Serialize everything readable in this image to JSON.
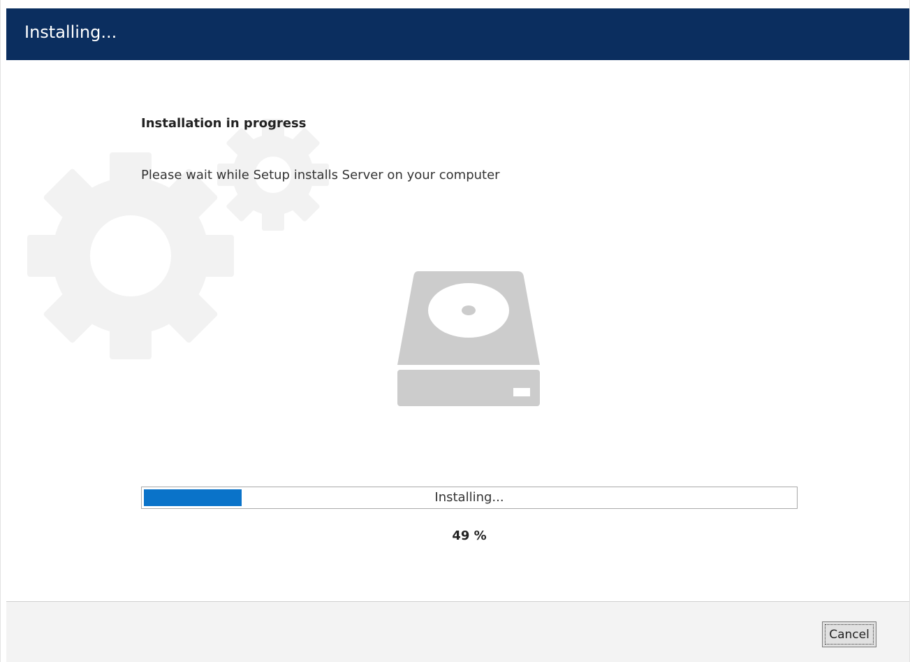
{
  "window": {
    "title": "Installing..."
  },
  "main": {
    "heading": "Installation in progress",
    "description": "Please wait while Setup installs Server on your computer",
    "illustration_icon": "hard-drive-icon",
    "background_icon": "gears-icon"
  },
  "progress": {
    "label": "Installing...",
    "percent_text": "49 %",
    "fill_fraction": 0.15,
    "fill_color": "#0a73c9"
  },
  "footer": {
    "cancel_label": "Cancel"
  },
  "colors": {
    "title_bar": "#0b2e5f",
    "footer_bg": "#f3f3f3",
    "gear_color": "#f2f2f2",
    "drive_color": "#cccccc"
  }
}
